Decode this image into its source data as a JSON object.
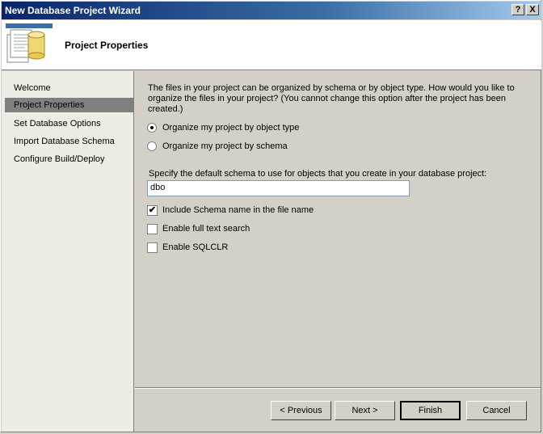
{
  "window": {
    "title": "New Database Project Wizard",
    "help_glyph": "?",
    "close_glyph": "X"
  },
  "header": {
    "title": "Project Properties"
  },
  "nav": {
    "items": [
      {
        "label": "Welcome",
        "active": false
      },
      {
        "label": "Project Properties",
        "active": true
      },
      {
        "label": "Set Database Options",
        "active": false
      },
      {
        "label": "Import Database Schema",
        "active": false
      },
      {
        "label": "Configure Build/Deploy",
        "active": false
      }
    ]
  },
  "content": {
    "description": "The files in your project can be organized by schema or by object type. How would you like to organize the files in your project? (You cannot change this option after the project has been created.)",
    "organize_options": [
      {
        "label": "Organize my project by object type",
        "checked": true
      },
      {
        "label": "Organize my project by schema",
        "checked": false
      }
    ],
    "schema_label": "Specify the default schema to use for objects that you create in your database project:",
    "schema_value": "dbo",
    "checkboxes": [
      {
        "label": "Include Schema name in the file name",
        "checked": true
      },
      {
        "label": "Enable full text search",
        "checked": false
      },
      {
        "label": "Enable SQLCLR",
        "checked": false
      }
    ],
    "check_glyph": "✔"
  },
  "footer": {
    "previous_label": "< Previous",
    "next_label": "Next >",
    "finish_label": "Finish",
    "cancel_label": "Cancel"
  }
}
